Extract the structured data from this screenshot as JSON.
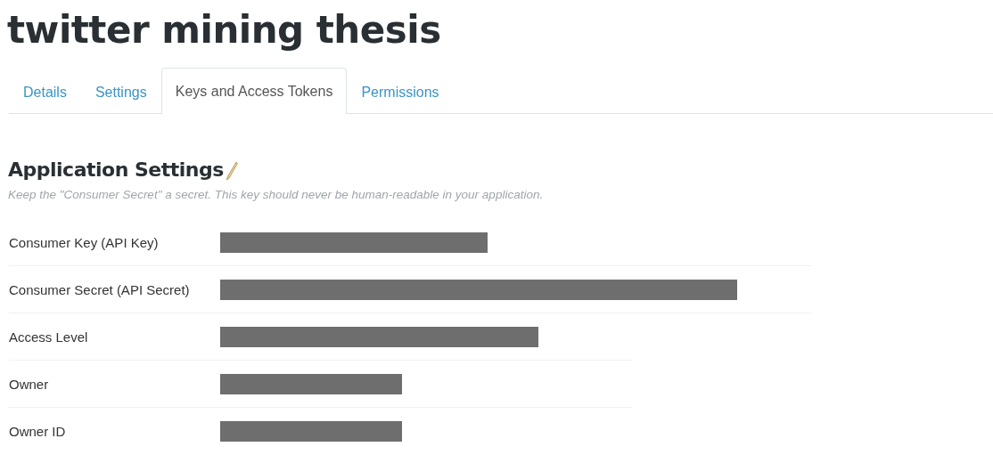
{
  "app_title": "twitter mining thesis",
  "tabs": [
    {
      "label": "Details",
      "selected": false
    },
    {
      "label": "Settings",
      "selected": false
    },
    {
      "label": "Keys and Access Tokens",
      "selected": true
    },
    {
      "label": "Permissions",
      "selected": false
    }
  ],
  "section": {
    "heading": "Application Settings",
    "note": "Keep the \"Consumer Secret\" a secret. This key should never be human-readable in your application."
  },
  "fields": [
    {
      "label": "Consumer Key (API Key)",
      "kind": "redacted"
    },
    {
      "label": "Consumer Secret (API Secret)",
      "kind": "redacted"
    },
    {
      "label": "Access Level",
      "kind": "redacted"
    },
    {
      "label": "Owner",
      "kind": "redacted"
    },
    {
      "label": "Owner ID",
      "kind": "redacted"
    }
  ]
}
